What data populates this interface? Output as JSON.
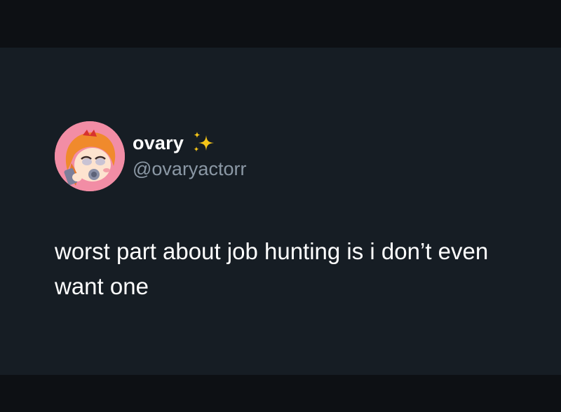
{
  "tweet": {
    "display_name": "ovary",
    "display_name_badge_icon": "sparkles-icon",
    "handle": "@ovaryactorr",
    "avatar_icon": "cartoon-girl-avatar",
    "text": "worst part about job hunting is i don’t even want one"
  },
  "colors": {
    "card_background": "#161d24",
    "letterbox": "#0d1014",
    "name_text": "#ffffff",
    "handle_text": "#8b98a5",
    "sparkle": "#f5c518",
    "avatar_background": "#f28da5"
  }
}
